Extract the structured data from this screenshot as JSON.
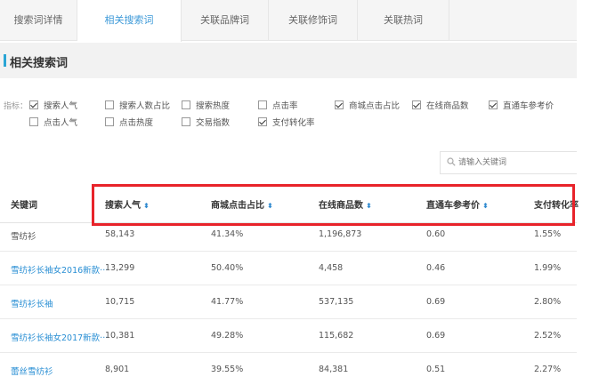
{
  "tabs": [
    {
      "label": "搜索词详情"
    },
    {
      "label": "相关搜索词"
    },
    {
      "label": "关联品牌词"
    },
    {
      "label": "关联修饰词"
    },
    {
      "label": "关联热词"
    }
  ],
  "section": {
    "title": "相关搜索词"
  },
  "filters": {
    "label": "指标：",
    "items": [
      {
        "label": "搜索人气",
        "checked": true
      },
      {
        "label": "搜索人数占比",
        "checked": false
      },
      {
        "label": "搜索热度",
        "checked": false
      },
      {
        "label": "点击率",
        "checked": false
      },
      {
        "label": "商城点击占比",
        "checked": true
      },
      {
        "label": "在线商品数",
        "checked": true
      },
      {
        "label": "直通车参考价",
        "checked": true
      },
      {
        "label": "点击人气",
        "checked": false
      },
      {
        "label": "点击热度",
        "checked": false
      },
      {
        "label": "交易指数",
        "checked": false
      },
      {
        "label": "支付转化率",
        "checked": true
      }
    ]
  },
  "search": {
    "placeholder": "请输入关键词",
    "icon": "search-icon"
  },
  "table": {
    "columns": [
      {
        "label": "关键词",
        "sortable": false
      },
      {
        "label": "搜索人气",
        "sortable": true
      },
      {
        "label": "商城点击占比",
        "sortable": true
      },
      {
        "label": "在线商品数",
        "sortable": true
      },
      {
        "label": "直通车参考价",
        "sortable": true
      },
      {
        "label": "支付转化率",
        "sortable": false
      }
    ],
    "sort_glyph": "⬍",
    "rows": [
      {
        "keyword": "雪纺衫",
        "link": false,
        "values": [
          "58,143",
          "41.34%",
          "1,196,873",
          "0.60",
          "1.55%"
        ]
      },
      {
        "keyword": "雪纺衫长袖女2016新款···",
        "link": true,
        "values": [
          "13,299",
          "50.40%",
          "4,458",
          "0.46",
          "1.99%"
        ]
      },
      {
        "keyword": "雪纺衫长袖",
        "link": true,
        "values": [
          "10,715",
          "41.77%",
          "537,135",
          "0.69",
          "2.80%"
        ]
      },
      {
        "keyword": "雪纺衫长袖女2017新款···",
        "link": true,
        "values": [
          "10,381",
          "49.28%",
          "115,682",
          "0.69",
          "2.52%"
        ]
      },
      {
        "keyword": "蕾丝雪纺衫",
        "link": true,
        "values": [
          "8,901",
          "39.55%",
          "84,381",
          "0.51",
          "2.27%"
        ]
      }
    ]
  },
  "colors": {
    "accent": "#3c99d8",
    "highlight": "#e8232a",
    "link": "#2a8fd4"
  }
}
